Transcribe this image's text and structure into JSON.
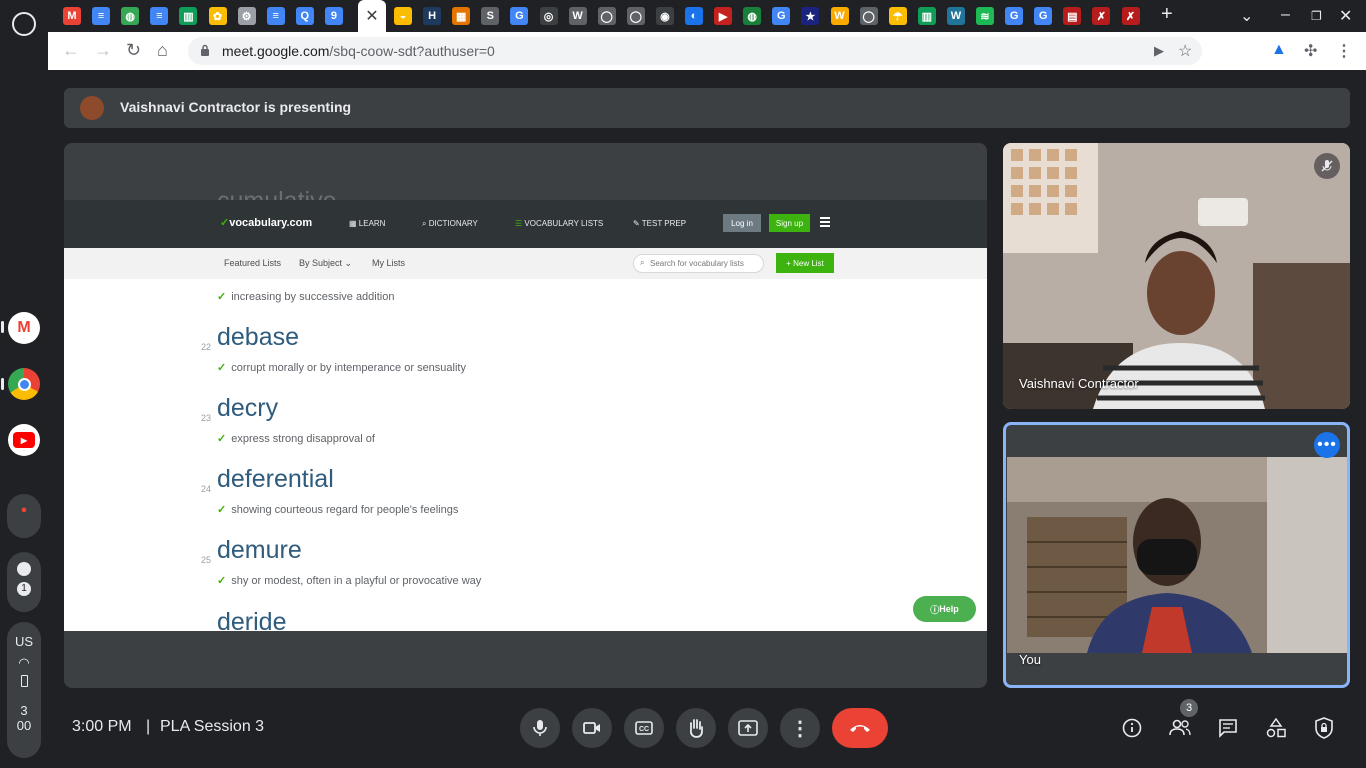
{
  "browser": {
    "url_host": "meet.google.com",
    "url_path": "/sbq-coow-sdt?authuser=0",
    "tab_favicons": [
      {
        "label": "M",
        "color": "#ea4335"
      },
      {
        "label": "≡",
        "color": "#4285f4"
      },
      {
        "label": "◍",
        "color": "#34a853"
      },
      {
        "label": "≡",
        "color": "#4285f4"
      },
      {
        "label": "▥",
        "color": "#0f9d58"
      },
      {
        "label": "✿",
        "color": "#fbbc04"
      },
      {
        "label": "⚙",
        "color": "#9aa0a6"
      },
      {
        "label": "≡",
        "color": "#4285f4"
      },
      {
        "label": "Q",
        "color": "#4285f4"
      },
      {
        "label": "9",
        "color": "#4285f4"
      },
      {
        "label": "◒",
        "color": "#fbbc04"
      },
      {
        "label": "H",
        "color": "#1e3a5f"
      },
      {
        "label": "▦",
        "color": "#e37400"
      },
      {
        "label": "S",
        "color": "#5f6368"
      },
      {
        "label": "G",
        "color": "#4285f4"
      },
      {
        "label": "◎",
        "color": "#3c4043"
      },
      {
        "label": "W",
        "color": "#5f6368"
      },
      {
        "label": "◯",
        "color": "#5f6368"
      },
      {
        "label": "◯",
        "color": "#5f6368"
      },
      {
        "label": "◉",
        "color": "#3c4043"
      },
      {
        "label": "◐",
        "color": "#1a73e8"
      },
      {
        "label": "▶",
        "color": "#c5221f"
      },
      {
        "label": "◍",
        "color": "#188038"
      },
      {
        "label": "G",
        "color": "#4285f4"
      },
      {
        "label": "★",
        "color": "#1a237e"
      },
      {
        "label": "W",
        "color": "#f9ab00"
      },
      {
        "label": "◯",
        "color": "#5f6368"
      },
      {
        "label": "☂",
        "color": "#fbbc04"
      },
      {
        "label": "▥",
        "color": "#0f9d58"
      },
      {
        "label": "W",
        "color": "#21759b"
      },
      {
        "label": "≋",
        "color": "#1db954"
      },
      {
        "label": "G",
        "color": "#4285f4"
      },
      {
        "label": "G",
        "color": "#4285f4"
      },
      {
        "label": "▤",
        "color": "#b71c1c"
      },
      {
        "label": "✗",
        "color": "#b71c1c"
      },
      {
        "label": "✗",
        "color": "#b71c1c"
      }
    ]
  },
  "meet": {
    "presenting_text": "Vaishnavi Contractor is presenting",
    "time": "3:00 PM",
    "separator": "|",
    "meeting_name": "PLA Session 3",
    "participant_count": "3",
    "tiles": {
      "presenter_name": "Vaishnavi Contractor",
      "self_name": "You"
    }
  },
  "shared_screen": {
    "logo": "vocabulary.com",
    "nav": [
      "LEARN",
      "DICTIONARY",
      "VOCABULARY LISTS",
      "TEST PREP"
    ],
    "login": "Log in",
    "signup": "Sign up",
    "subnav": [
      "Featured Lists",
      "By Subject",
      "My Lists"
    ],
    "search_placeholder": "Search for vocabulary lists",
    "new_list": "+ New List",
    "partial_word_top": "cumulative",
    "partial_def_top": "increasing by successive addition",
    "entries": [
      {
        "num": "22",
        "word": "debase",
        "def": "corrupt morally or by intemperance or sensuality"
      },
      {
        "num": "23",
        "word": "decry",
        "def": "express strong disapproval of"
      },
      {
        "num": "24",
        "word": "deferential",
        "def": "showing courteous regard for people's feelings"
      },
      {
        "num": "25",
        "word": "demure",
        "def": "shy or modest, often in a playful or provocative way"
      }
    ],
    "partial_word_bottom": "deride",
    "help": "Help"
  },
  "system_shelf": {
    "status_count": "1",
    "ime": "US",
    "clock_hour": "3",
    "clock_min": "00"
  }
}
